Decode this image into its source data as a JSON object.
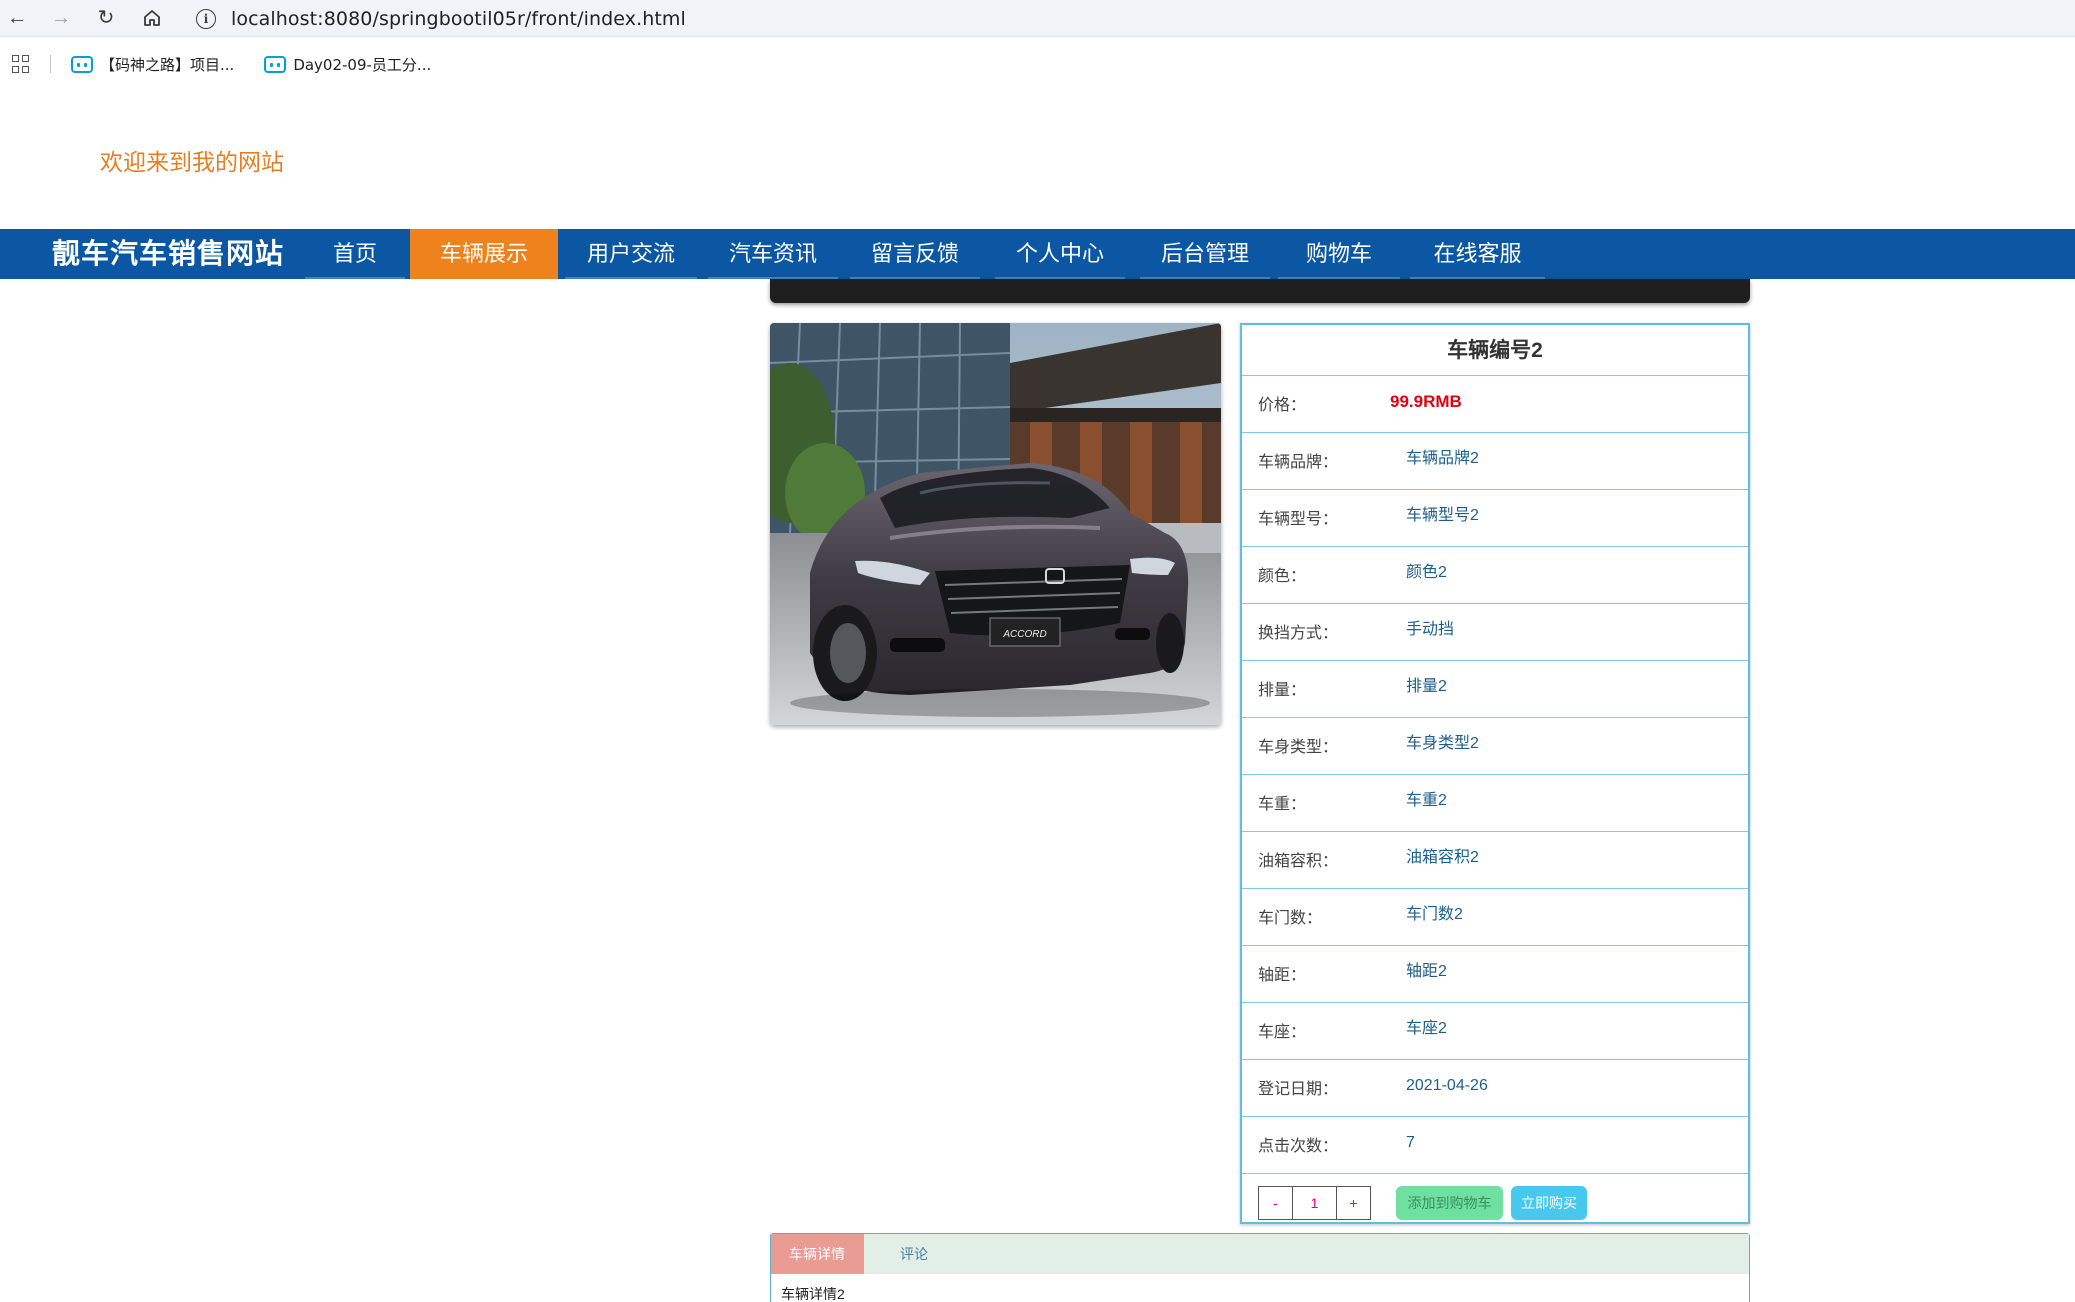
{
  "browser": {
    "url": "localhost:8080/springbootil05r/front/index.html",
    "bookmarks": [
      "【码神之路】项目...",
      "Day02-09-员工分..."
    ]
  },
  "site": {
    "welcome": "欢迎来到我的网站",
    "brand": "靓车汽车销售网站",
    "nav": [
      "首页",
      "车辆展示",
      "用户交流",
      "汽车资讯",
      "留言反馈",
      "个人中心",
      "后台管理",
      "购物车",
      "在线客服"
    ],
    "active_nav": "车辆展示"
  },
  "product": {
    "title": "车辆编号2",
    "image_badge": "ACCORD",
    "fields": [
      {
        "label": "价格：",
        "value": "99.9RMB"
      },
      {
        "label": "车辆品牌：",
        "value": "车辆品牌2"
      },
      {
        "label": "车辆型号：",
        "value": "车辆型号2"
      },
      {
        "label": "颜色：",
        "value": "颜色2"
      },
      {
        "label": "换挡方式：",
        "value": "手动挡"
      },
      {
        "label": "排量：",
        "value": "排量2"
      },
      {
        "label": "车身类型：",
        "value": "车身类型2"
      },
      {
        "label": "车重：",
        "value": "车重2"
      },
      {
        "label": "油箱容积：",
        "value": "油箱容积2"
      },
      {
        "label": "车门数：",
        "value": "车门数2"
      },
      {
        "label": "轴距：",
        "value": "轴距2"
      },
      {
        "label": "车座：",
        "value": "车座2"
      },
      {
        "label": "登记日期：",
        "value": "2021-04-26"
      },
      {
        "label": "点击次数：",
        "value": "7"
      }
    ],
    "quantity": {
      "minus": "-",
      "value": "1",
      "plus": "+"
    },
    "add_to_cart": "添加到购物车",
    "buy_now": "立即购买"
  },
  "tabs": {
    "items": [
      "车辆详情",
      "评论"
    ],
    "content": "车辆详情2"
  },
  "colors": {
    "nav_bg": "#0b57a4",
    "nav_active": "#f0821e",
    "welcome": "#e67e22",
    "price": "#e60012",
    "table_border": "#7ccbe6"
  }
}
